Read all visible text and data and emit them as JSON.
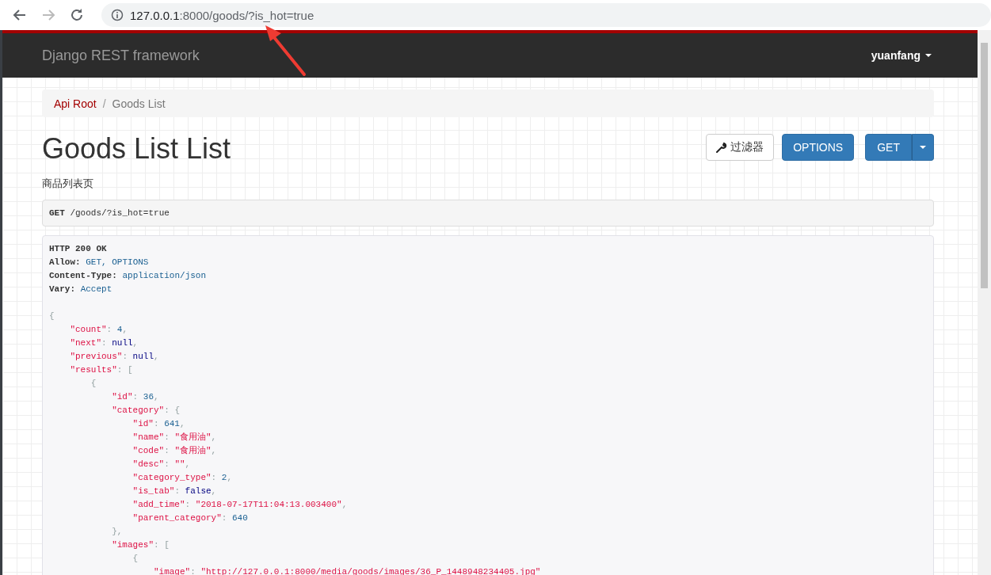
{
  "browser": {
    "url_host": "127.0.0.1",
    "url_rest": ":8000/goods/?is_hot=true"
  },
  "navbar": {
    "brand": "Django REST framework",
    "user": "yuanfang"
  },
  "breadcrumb": {
    "separator": "/",
    "items": [
      {
        "label": "Api Root",
        "selected": false
      },
      {
        "label": "Goods List",
        "selected": true
      }
    ]
  },
  "page": {
    "title": "Goods List List",
    "description": "商品列表页",
    "buttons": [
      {
        "kind": "filter",
        "label": "过滤器"
      },
      {
        "kind": "primary",
        "label": "OPTIONS"
      },
      {
        "kind": "split",
        "label": "GET"
      }
    ]
  },
  "request": {
    "method": "GET",
    "path": "/goods/?is_hot=true"
  },
  "response": {
    "status": "HTTP 200 OK",
    "headers": [
      {
        "name": "Allow:",
        "value": "GET, OPTIONS"
      },
      {
        "name": "Content-Type:",
        "value": "application/json"
      },
      {
        "name": "Vary:",
        "value": "Accept"
      }
    ],
    "body": [
      {
        "tokens": [
          {
            "kind": "punct",
            "text": "{"
          }
        ],
        "children": [
          {
            "tokens": [
              {
                "kind": "key",
                "text": "\"count\""
              },
              {
                "kind": "punct",
                "text": ": "
              },
              {
                "kind": "number",
                "text": "4"
              },
              {
                "kind": "punct",
                "text": ","
              }
            ]
          },
          {
            "tokens": [
              {
                "kind": "key",
                "text": "\"next\""
              },
              {
                "kind": "punct",
                "text": ": "
              },
              {
                "kind": "literal",
                "text": "null"
              },
              {
                "kind": "punct",
                "text": ","
              }
            ]
          },
          {
            "tokens": [
              {
                "kind": "key",
                "text": "\"previous\""
              },
              {
                "kind": "punct",
                "text": ": "
              },
              {
                "kind": "literal",
                "text": "null"
              },
              {
                "kind": "punct",
                "text": ","
              }
            ]
          },
          {
            "tokens": [
              {
                "kind": "key",
                "text": "\"results\""
              },
              {
                "kind": "punct",
                "text": ": ["
              }
            ],
            "children": [
              {
                "tokens": [
                  {
                    "kind": "punct",
                    "text": "{"
                  }
                ],
                "children": [
                  {
                    "tokens": [
                      {
                        "kind": "key",
                        "text": "\"id\""
                      },
                      {
                        "kind": "punct",
                        "text": ": "
                      },
                      {
                        "kind": "number",
                        "text": "36"
                      },
                      {
                        "kind": "punct",
                        "text": ","
                      }
                    ]
                  },
                  {
                    "tokens": [
                      {
                        "kind": "key",
                        "text": "\"category\""
                      },
                      {
                        "kind": "punct",
                        "text": ": {"
                      }
                    ],
                    "children": [
                      {
                        "tokens": [
                          {
                            "kind": "key",
                            "text": "\"id\""
                          },
                          {
                            "kind": "punct",
                            "text": ": "
                          },
                          {
                            "kind": "number",
                            "text": "641"
                          },
                          {
                            "kind": "punct",
                            "text": ","
                          }
                        ]
                      },
                      {
                        "tokens": [
                          {
                            "kind": "key",
                            "text": "\"name\""
                          },
                          {
                            "kind": "punct",
                            "text": ": "
                          },
                          {
                            "kind": "string",
                            "text": "\"食用油\""
                          },
                          {
                            "kind": "punct",
                            "text": ","
                          }
                        ]
                      },
                      {
                        "tokens": [
                          {
                            "kind": "key",
                            "text": "\"code\""
                          },
                          {
                            "kind": "punct",
                            "text": ": "
                          },
                          {
                            "kind": "string",
                            "text": "\"食用油\""
                          },
                          {
                            "kind": "punct",
                            "text": ","
                          }
                        ]
                      },
                      {
                        "tokens": [
                          {
                            "kind": "key",
                            "text": "\"desc\""
                          },
                          {
                            "kind": "punct",
                            "text": ": "
                          },
                          {
                            "kind": "string",
                            "text": "\"\""
                          },
                          {
                            "kind": "punct",
                            "text": ","
                          }
                        ]
                      },
                      {
                        "tokens": [
                          {
                            "kind": "key",
                            "text": "\"category_type\""
                          },
                          {
                            "kind": "punct",
                            "text": ": "
                          },
                          {
                            "kind": "number",
                            "text": "2"
                          },
                          {
                            "kind": "punct",
                            "text": ","
                          }
                        ]
                      },
                      {
                        "tokens": [
                          {
                            "kind": "key",
                            "text": "\"is_tab\""
                          },
                          {
                            "kind": "punct",
                            "text": ": "
                          },
                          {
                            "kind": "literal",
                            "text": "false"
                          },
                          {
                            "kind": "punct",
                            "text": ","
                          }
                        ]
                      },
                      {
                        "tokens": [
                          {
                            "kind": "key",
                            "text": "\"add_time\""
                          },
                          {
                            "kind": "punct",
                            "text": ": "
                          },
                          {
                            "kind": "string",
                            "text": "\"2018-07-17T11:04:13.003400\""
                          },
                          {
                            "kind": "punct",
                            "text": ","
                          }
                        ]
                      },
                      {
                        "tokens": [
                          {
                            "kind": "key",
                            "text": "\"parent_category\""
                          },
                          {
                            "kind": "punct",
                            "text": ": "
                          },
                          {
                            "kind": "number",
                            "text": "640"
                          }
                        ]
                      }
                    ]
                  },
                  {
                    "tokens": [
                      {
                        "kind": "punct",
                        "text": "},"
                      }
                    ]
                  },
                  {
                    "tokens": [
                      {
                        "kind": "key",
                        "text": "\"images\""
                      },
                      {
                        "kind": "punct",
                        "text": ": ["
                      }
                    ],
                    "children": [
                      {
                        "tokens": [
                          {
                            "kind": "punct",
                            "text": "{"
                          }
                        ],
                        "children": [
                          {
                            "tokens": [
                              {
                                "kind": "key",
                                "text": "\"image\""
                              },
                              {
                                "kind": "punct",
                                "text": ": "
                              },
                              {
                                "kind": "string",
                                "text": "\"http://127.0.0.1:8000/media/goods/images/36_P_1448948234405.jpg\""
                              }
                            ]
                          }
                        ]
                      }
                    ]
                  }
                ]
              }
            ]
          }
        ]
      }
    ]
  }
}
